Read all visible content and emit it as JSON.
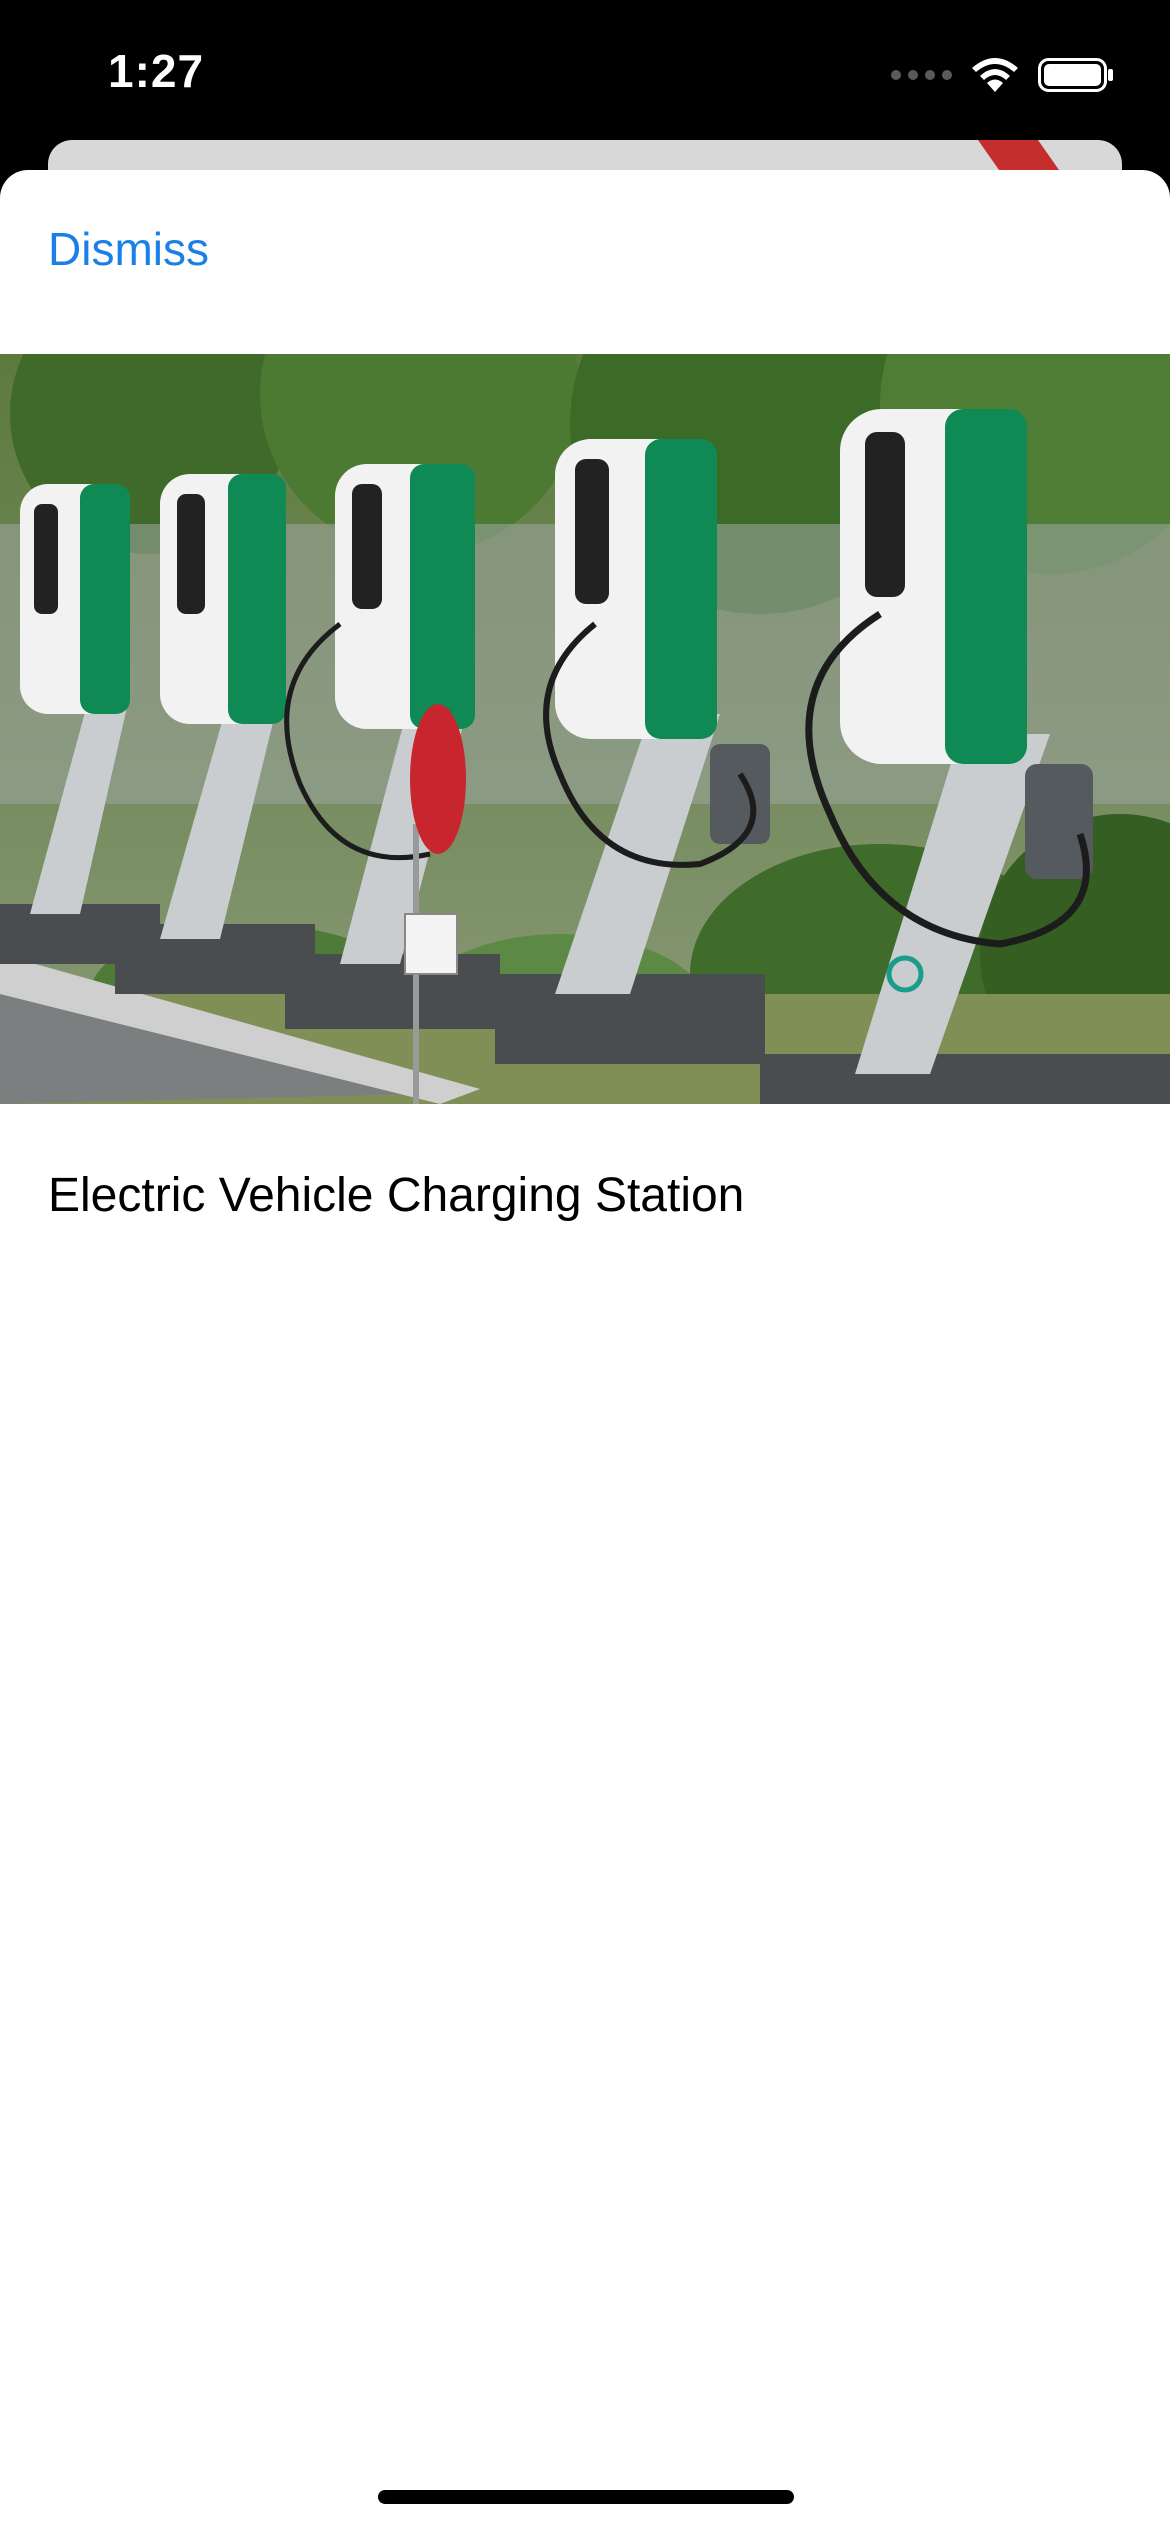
{
  "status_bar": {
    "time": "1:27",
    "icons": [
      "cellular-signal-icon",
      "wifi-icon",
      "battery-icon"
    ]
  },
  "sheet": {
    "dismiss_label": "Dismiss",
    "image": {
      "subject": "ev-charging-stations-photo"
    },
    "caption": "Electric Vehicle Charging Station"
  },
  "colors": {
    "accent": "#1a7fe6",
    "background": "#ffffff",
    "status_bar_background": "#000000"
  }
}
